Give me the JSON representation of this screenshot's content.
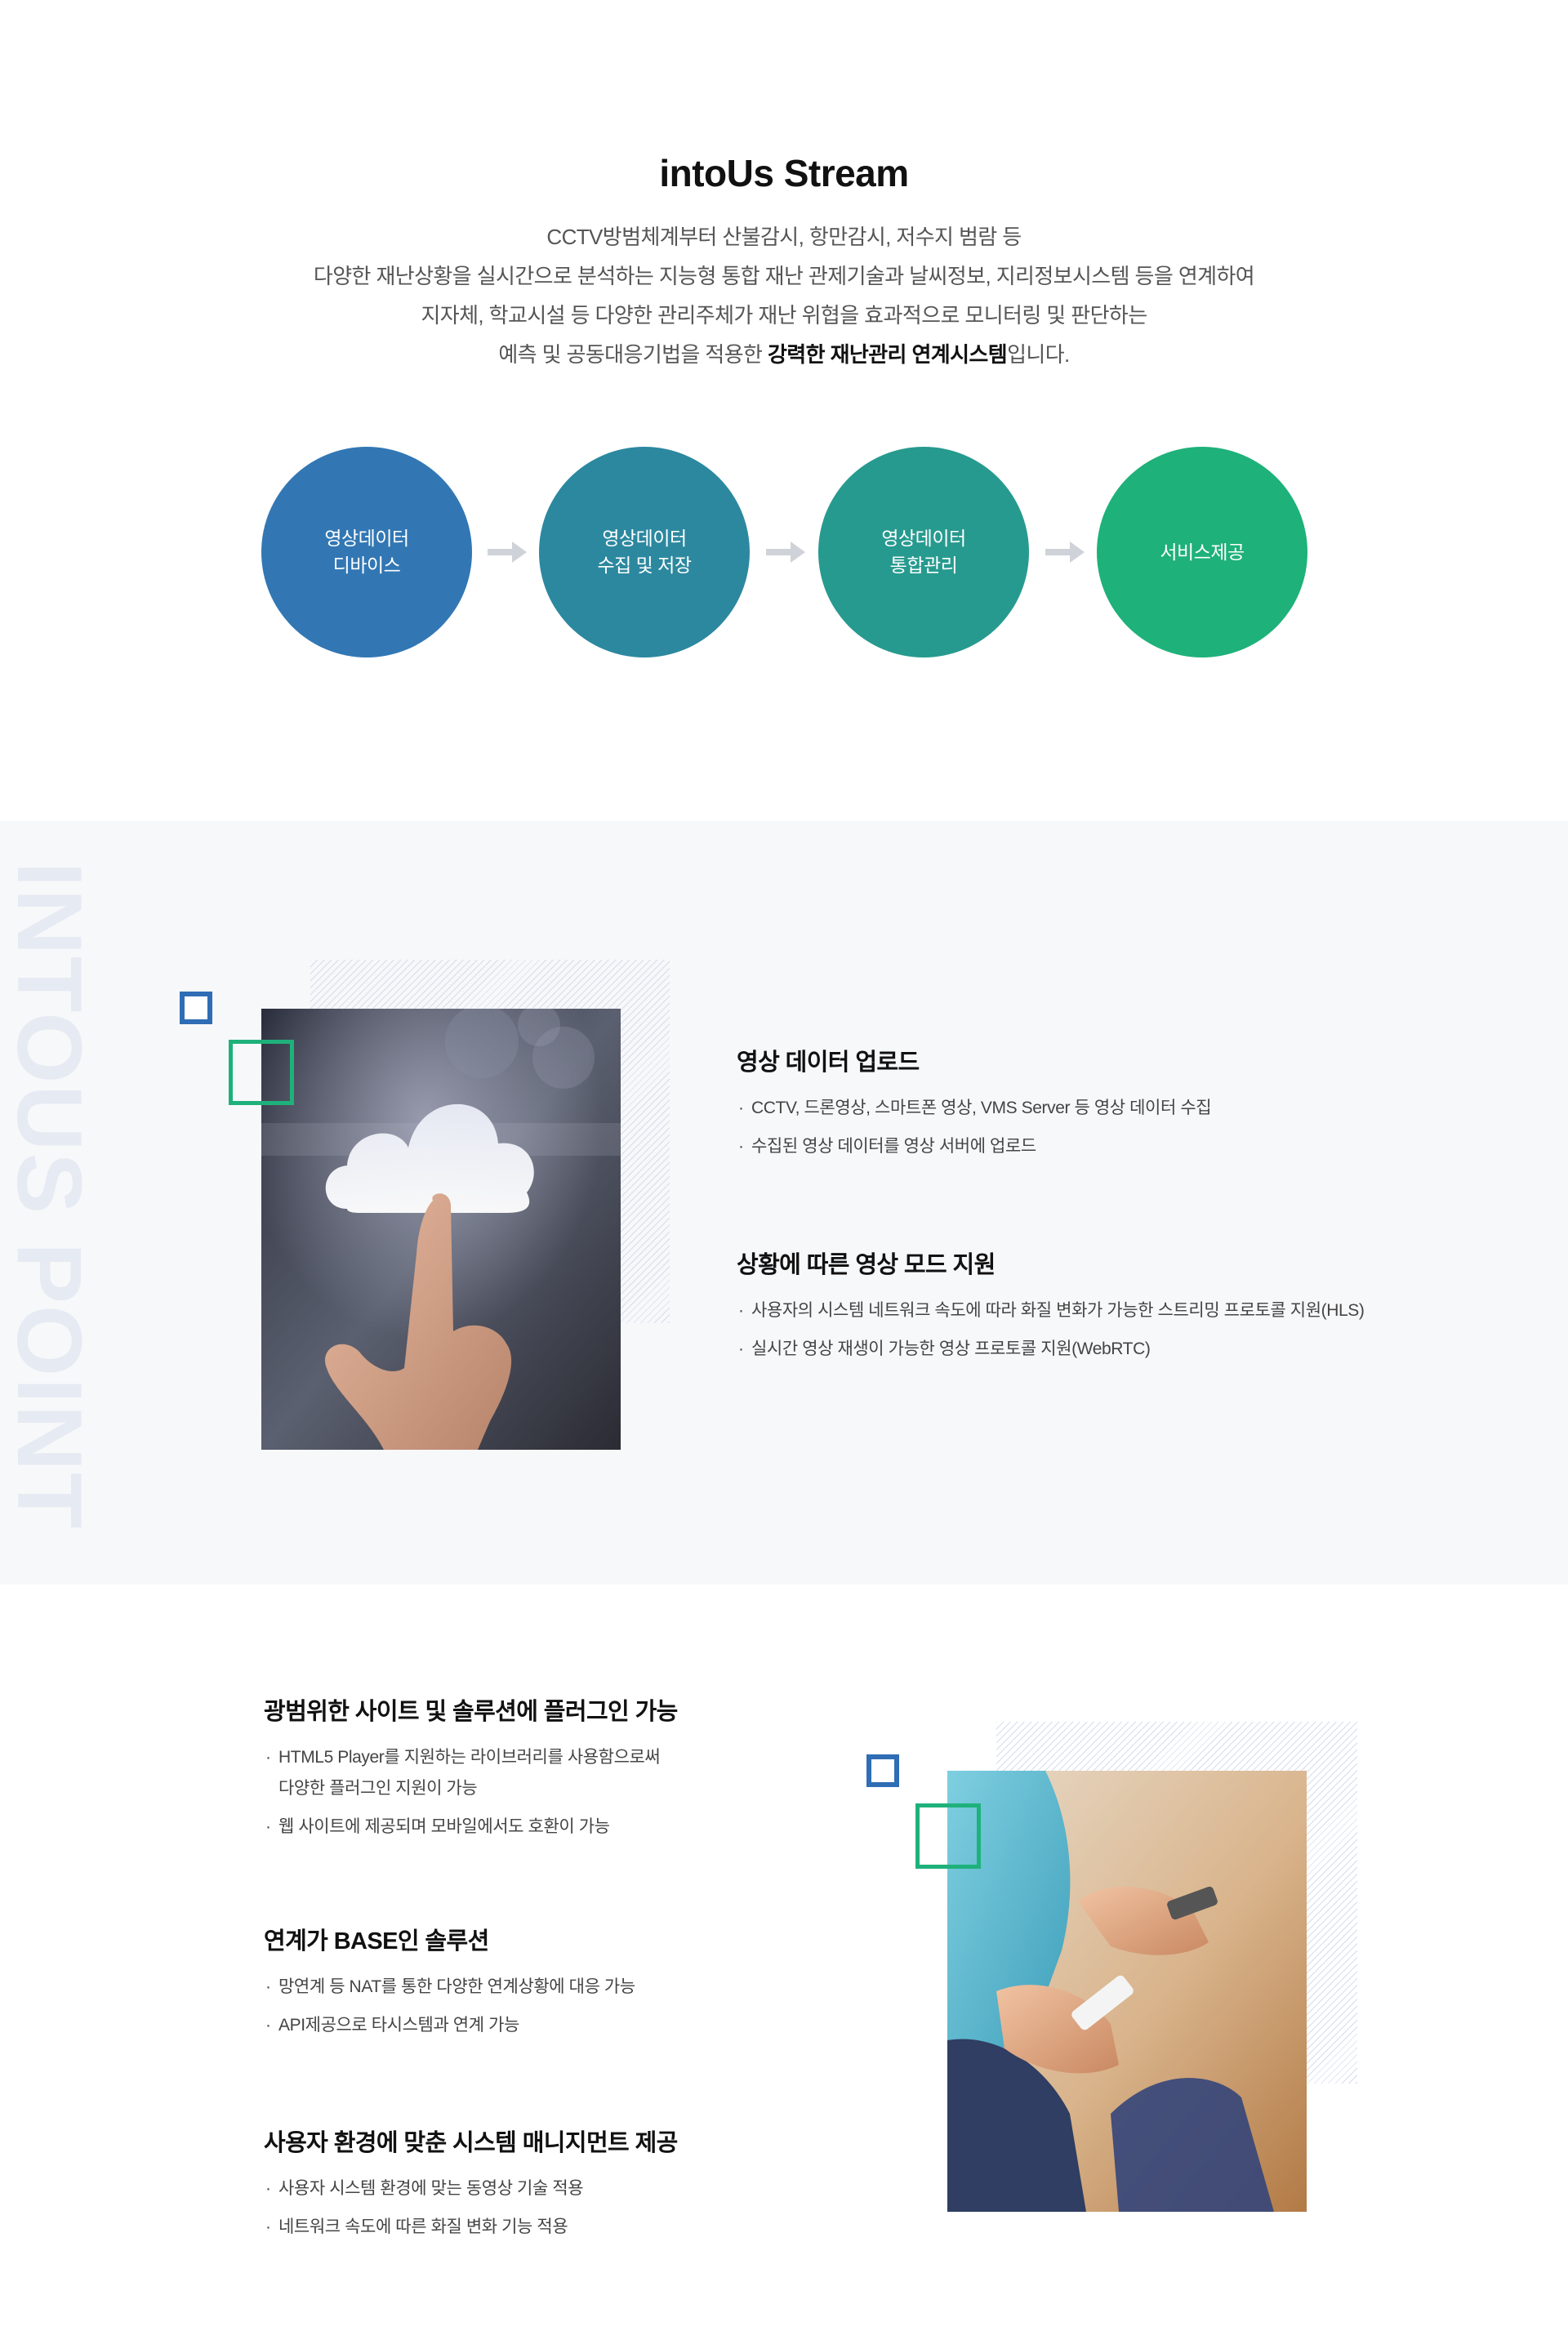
{
  "intro": {
    "title": "intoUs Stream",
    "line1": "CCTV방범체계부터 산불감시, 항만감시, 저수지 범람 등",
    "line2": "다양한 재난상황을 실시간으로 분석하는 지능형 통합 재난 관제기술과 날씨정보, 지리정보시스템 등을 연계하여",
    "line3": "지자체, 학교시설 등 다양한 관리주체가 재난 위협을 효과적으로 모니터링 및 판단하는",
    "line4_pre": "예측 및 공동대응기법을 적용한 ",
    "line4_bold": "강력한 재난관리 연계시스템",
    "line4_post": "입니다."
  },
  "flow": {
    "steps": [
      {
        "label": "영상데이터\n디바이스",
        "color": "#3277b4"
      },
      {
        "label": "영상데이터\n수집 및 저장",
        "color": "#2c889f"
      },
      {
        "label": "영상데이터\n통합관리",
        "color": "#279a8f"
      },
      {
        "label": "서비스제공",
        "color": "#1eb17a"
      }
    ],
    "arrow_color": "#cfd3d9"
  },
  "point": {
    "watermark": "INTOUS POINT",
    "features": [
      {
        "title": "영상 데이터 업로드",
        "items": [
          "CCTV, 드론영상, 스마트폰 영상, VMS Server 등 영상 데이터 수집",
          "수집된 영상 데이터를 영상 서버에 업로드"
        ]
      },
      {
        "title": "상황에 따른 영상 모드 지원",
        "items": [
          "사용자의 시스템 네트워크 속도에 따라 화질 변화가 가능한 스트리밍 프로토콜 지원(HLS)",
          "실시간 영상 재생이 가능한 영상 프로토콜 지원(WebRTC)"
        ]
      }
    ]
  },
  "bottom": {
    "features": [
      {
        "title": "광범위한 사이트 및 솔루션에 플러그인 가능",
        "item1_line1": "HTML5 Player를 지원하는 라이브러리를 사용함으로써",
        "item1_line2": "다양한 플러그인 지원이 가능",
        "item2": "웹 사이트에 제공되며 모바일에서도 호환이 가능"
      },
      {
        "title": "연계가 BASE인 솔루션",
        "items": [
          "망연계 등 NAT를 통한 다양한 연계상황에 대응 가능",
          "API제공으로 타시스템과 연계 가능"
        ]
      },
      {
        "title": "사용자 환경에 맞춘 시스템 매니지먼트 제공",
        "items": [
          "사용자 시스템 환경에 맞는 동영상 기술 적용",
          "네트워크 속도에 따른 화질 변화 기능 적용"
        ]
      }
    ]
  },
  "colors": {
    "accent_blue": "#2f6db5",
    "accent_green": "#1fb17b",
    "section_gray": "#f7f8fa"
  }
}
